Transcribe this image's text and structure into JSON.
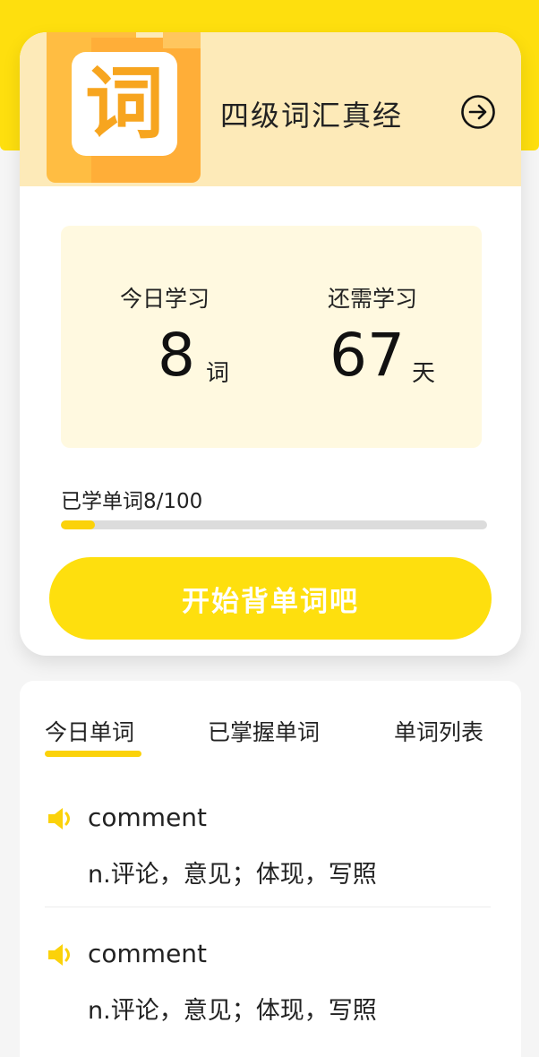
{
  "book": {
    "logo_char": "词",
    "title": "四级词汇真经"
  },
  "stats": {
    "today_label": "今日学习",
    "today_value": "8",
    "today_unit": "词",
    "remaining_label": "还需学习",
    "remaining_value": "67",
    "remaining_unit": "天"
  },
  "progress": {
    "label": "已学单词8/100",
    "learned": 8,
    "total": 100
  },
  "start_button": {
    "label": "开始背单词吧"
  },
  "tabs": [
    {
      "label": "今日单词",
      "active": true
    },
    {
      "label": "已掌握单词",
      "active": false
    },
    {
      "label": "单词列表",
      "active": false
    }
  ],
  "words": [
    {
      "word": "comment",
      "meaning": "n.评论，意见；体现，写照"
    },
    {
      "word": "comment",
      "meaning": "n.评论，意见；体现，写照"
    }
  ],
  "colors": {
    "accent": "#fedf0e",
    "header_bg": "#fdeab8",
    "stats_bg": "#fff9e0",
    "logo_orange": "#f7a51f",
    "progress_fill": "#fbd20a"
  },
  "icons": {
    "arrow": "arrow-right-circle-icon",
    "speaker": "speaker-icon"
  }
}
